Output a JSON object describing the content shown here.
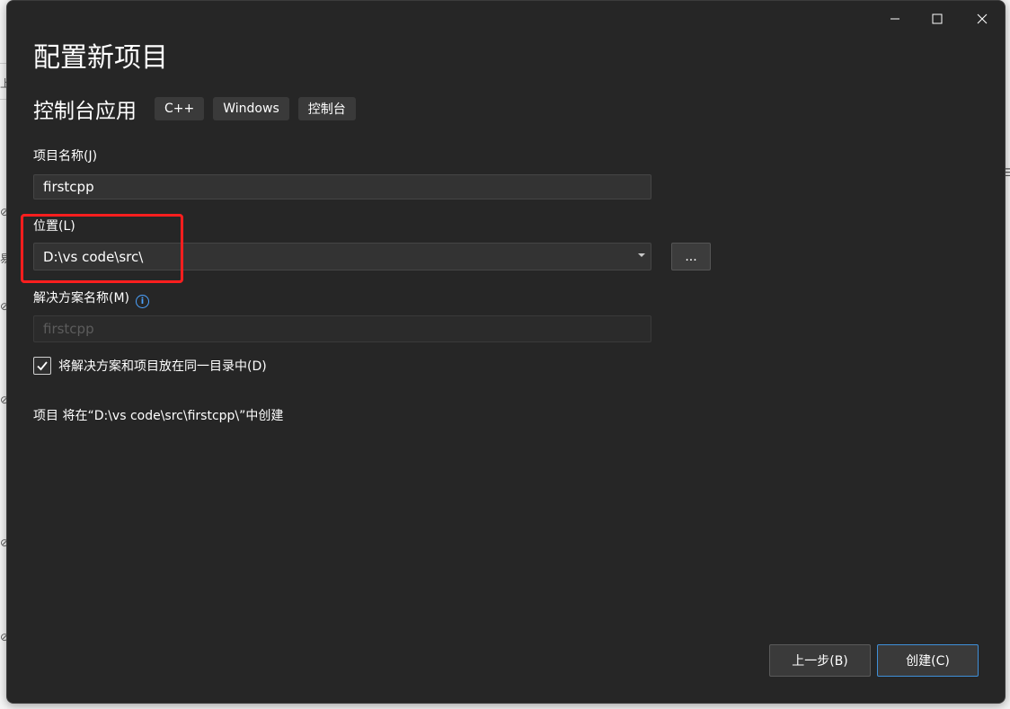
{
  "window": {
    "title": "配置新项目",
    "controls": {
      "minimize": "minimize",
      "maximize": "maximize",
      "close": "close"
    }
  },
  "template": {
    "name": "控制台应用",
    "tags": [
      "C++",
      "Windows",
      "控制台"
    ]
  },
  "form": {
    "project_name_label": "项目名称(J)",
    "project_name_value": "firstcpp",
    "location_label": "位置(L)",
    "location_value": "D:\\vs code\\src\\",
    "browse_label": "...",
    "solution_name_label": "解决方案名称(M)",
    "solution_name_value": "firstcpp",
    "same_dir_label": "将解决方案和项目放在同一目录中(D)",
    "same_dir_checked": true,
    "summary": "项目 将在“D:\\vs code\\src\\firstcpp\\”中创建"
  },
  "buttons": {
    "back": "上一步(B)",
    "create": "创建(C)"
  },
  "colors": {
    "dialog_bg": "#262626",
    "input_bg": "#333333",
    "tag_bg": "#3a3a3a",
    "accent": "#3f8fd8",
    "highlight": "#ff1e1e",
    "info": "#4ca3ff"
  }
}
